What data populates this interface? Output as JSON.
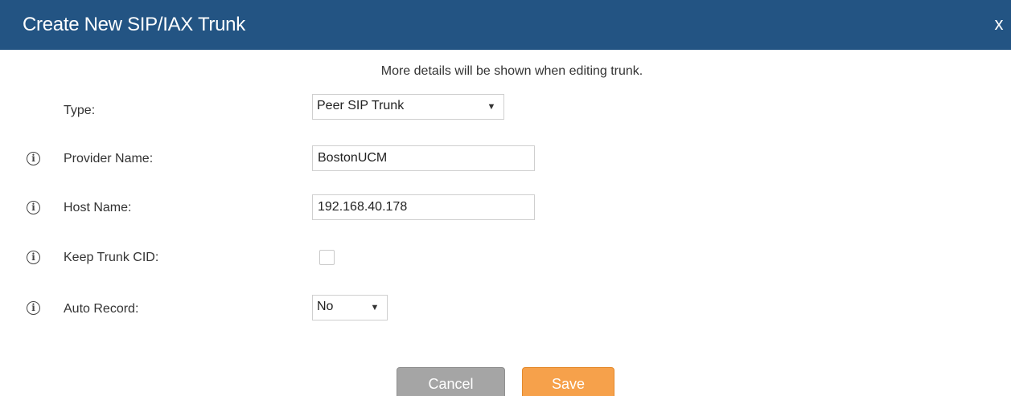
{
  "dialog": {
    "title": "Create New SIP/IAX Trunk",
    "close_label": "x",
    "hint": "More details will be shown when editing trunk."
  },
  "form": {
    "type": {
      "label": "Type:",
      "value": "Peer SIP Trunk"
    },
    "provider_name": {
      "label": "Provider Name:",
      "value": "BostonUCM"
    },
    "host_name": {
      "label": "Host Name:",
      "value": "192.168.40.178"
    },
    "keep_trunk_cid": {
      "label": "Keep Trunk CID:",
      "checked": false
    },
    "auto_record": {
      "label": "Auto Record:",
      "value": "No"
    }
  },
  "buttons": {
    "cancel_label": "Cancel",
    "save_label": "Save"
  },
  "icons": {
    "info_glyph": "i",
    "dropdown_glyph": "▼"
  },
  "colors": {
    "titlebar": "#235483",
    "cancel": "#a5a5a5",
    "save": "#f6a14b"
  }
}
